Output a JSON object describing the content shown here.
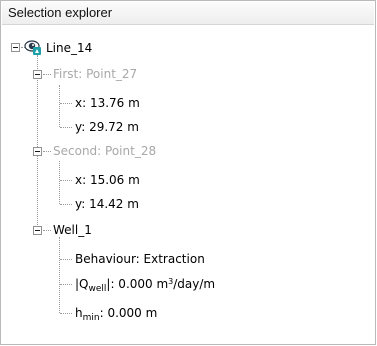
{
  "panel": {
    "title": "Selection explorer"
  },
  "tree": {
    "root": {
      "label": "Line_14",
      "icon": "eye-icon",
      "first": {
        "label": "First: Point_27",
        "x": "x: 13.76 m",
        "y": "y: 29.72 m"
      },
      "second": {
        "label": "Second: Point_28",
        "x": "x: 15.06 m",
        "y": "y: 14.42 m"
      },
      "well": {
        "label": "Well_1",
        "behaviour": "Behaviour: Extraction",
        "q_prefix": "|Q",
        "q_sub": "well",
        "q_suffix": "|: 0.000 m",
        "q_sup": "3",
        "q_unit": "/day/m",
        "h_prefix": "h",
        "h_sub": "min",
        "h_suffix": ": 0.000 m"
      }
    }
  },
  "colors": {
    "muted": "#a8a8a8",
    "eye_teal": "#1ea0a8",
    "eye_dark": "#2b3a4a"
  }
}
